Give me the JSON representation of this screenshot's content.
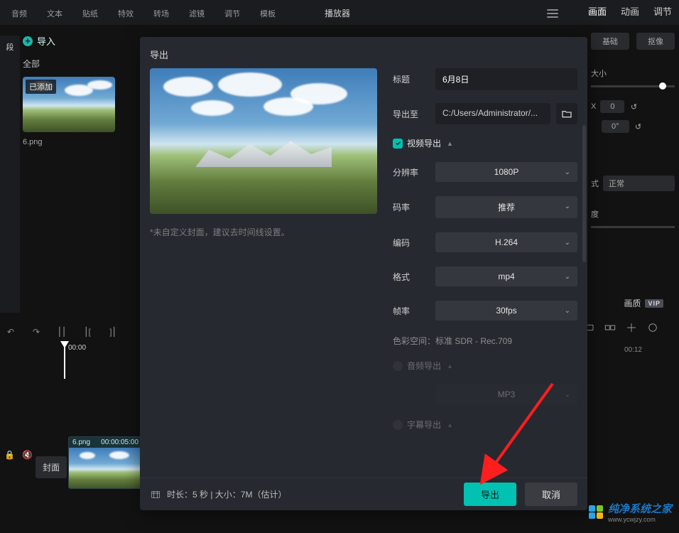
{
  "toolbar": {
    "items": [
      {
        "label": "音频",
        "glyph": "audio"
      },
      {
        "label": "文本",
        "glyph": "text"
      },
      {
        "label": "贴纸",
        "glyph": "sticker"
      },
      {
        "label": "特效",
        "glyph": "fx"
      },
      {
        "label": "转场",
        "glyph": "transition"
      },
      {
        "label": "滤镜",
        "glyph": "filter"
      },
      {
        "label": "调节",
        "glyph": "adjust"
      },
      {
        "label": "模板",
        "glyph": "template"
      }
    ]
  },
  "player": {
    "title": "播放器"
  },
  "right": {
    "tabs": [
      "画面",
      "动画",
      "调节"
    ],
    "active": 0,
    "btn1": "基础",
    "btn2": "抠像",
    "size_label": "大小",
    "x_label": "X",
    "x_value": "0",
    "rot_value": "0°",
    "mode_label": "式",
    "mode_value": "正常",
    "another_label": "度"
  },
  "sidebar": {
    "s1": "段"
  },
  "import": {
    "label": "导入",
    "all": "全部",
    "thumb_badge": "已添加",
    "thumb_name": "6.png"
  },
  "modal": {
    "title": "导出",
    "form": {
      "title_label": "标题",
      "title_value": "6月8日",
      "path_label": "导出至",
      "path_value": "C:/Users/Administrator/...",
      "video_section": "视频导出",
      "resolution_label": "分辨率",
      "resolution_value": "1080P",
      "bitrate_label": "码率",
      "bitrate_value": "推荐",
      "encode_label": "编码",
      "encode_value": "H.264",
      "format_label": "格式",
      "format_value": "mp4",
      "fps_label": "帧率",
      "fps_value": "30fps",
      "colorspace": "色彩空间：标准 SDR - Rec.709",
      "audio_section": "音频导出",
      "audio_format_value": "MP3",
      "subtitle_section": "字幕导出"
    },
    "preview_note": "*未自定义封面，建议去时间线设置。",
    "footer_info": "时长：5 秒 | 大小：7M（估计）",
    "export_btn": "导出",
    "cancel_btn": "取消"
  },
  "timeline": {
    "playhead_time": "00:00",
    "right_marker": "00:12",
    "face": "封面",
    "clip_name": "6.png",
    "clip_time": "00:00:05:00"
  },
  "quality": {
    "label": "画质",
    "vip": "VIP"
  },
  "watermark": {
    "text": "纯净系统之家",
    "url": "www.ycwjzy.com"
  }
}
